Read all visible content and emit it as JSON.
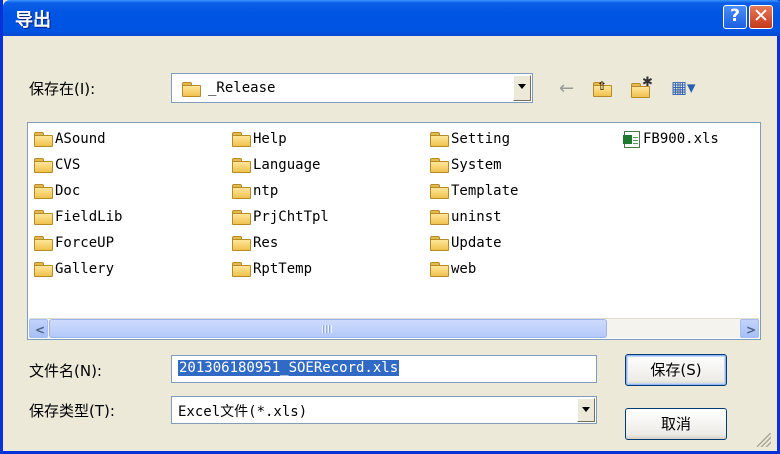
{
  "window": {
    "title": "导出"
  },
  "titlebar": {
    "help_label": "?",
    "close_label": "✕"
  },
  "save_in": {
    "label": "保存在(I):",
    "value": "_Release"
  },
  "toolbar": {
    "back_glyph": "←",
    "up_glyph": "⇧",
    "new_folder_glyph": "✱",
    "view_glyph": "▦▾"
  },
  "files": {
    "columns": [
      [
        "ASound",
        "CVS",
        "Doc",
        "FieldLib",
        "ForceUP",
        "Gallery"
      ],
      [
        "Help",
        "Language",
        "ntp",
        "PrjChtTpl",
        "Res",
        "RptTemp"
      ],
      [
        "Setting",
        "System",
        "Template",
        "uninst",
        "Update",
        "web"
      ]
    ],
    "xls_file": "FB900.xls"
  },
  "filename": {
    "label": "文件名(N):",
    "value": "201306180951_SOERecord.xls"
  },
  "filetype": {
    "label": "保存类型(T):",
    "value": "Excel文件(*.xls)"
  },
  "buttons": {
    "save": "保存(S)",
    "cancel": "取消"
  }
}
